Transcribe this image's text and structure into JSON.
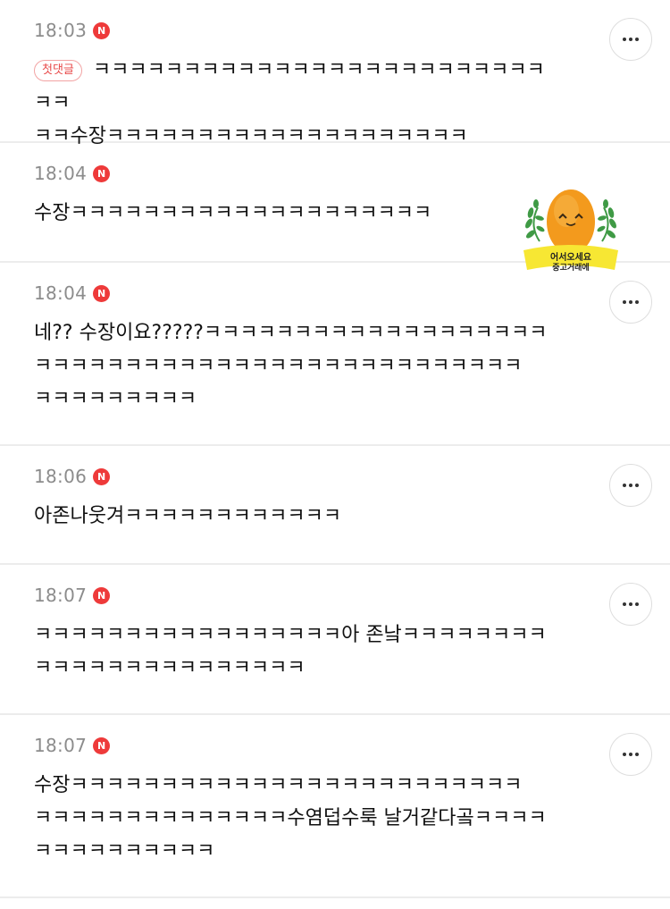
{
  "comments": [
    {
      "time": "18:03",
      "new_badge": "N",
      "first_badge": "첫댓글",
      "text": "ㅋㅋㅋㅋㅋㅋㅋㅋㅋㅋㅋㅋㅋㅋㅋㅋㅋㅋㅋㅋㅋㅋㅋㅋㅋㅋㅋ\nㅋㅋ수장ㅋㅋㅋㅋㅋㅋㅋㅋㅋㅋㅋㅋㅋㅋㅋㅋㅋㅋㅋㅋ"
    },
    {
      "time": "18:04",
      "new_badge": "N",
      "text": "수장ㅋㅋㅋㅋㅋㅋㅋㅋㅋㅋㅋㅋㅋㅋㅋㅋㅋㅋㅋㅋ",
      "sticker": {
        "line1": "어서오세요",
        "line2": "중고거래에"
      }
    },
    {
      "time": "18:04",
      "new_badge": "N",
      "text": "네?? 수장이요?????ㅋㅋㅋㅋㅋㅋㅋㅋㅋㅋㅋㅋㅋㅋㅋㅋㅋㅋㅋ\nㅋㅋㅋㅋㅋㅋㅋㅋㅋㅋㅋㅋㅋㅋㅋㅋㅋㅋㅋㅋㅋㅋㅋㅋㅋㅋㅋ\nㅋㅋㅋㅋㅋㅋㅋㅋㅋ"
    },
    {
      "time": "18:06",
      "new_badge": "N",
      "text": "아존나웃겨ㅋㅋㅋㅋㅋㅋㅋㅋㅋㅋㅋㅋ"
    },
    {
      "time": "18:07",
      "new_badge": "N",
      "text": "ㅋㅋㅋㅋㅋㅋㅋㅋㅋㅋㅋㅋㅋㅋㅋㅋㅋ아 존낰ㅋㅋㅋㅋㅋㅋㅋㅋ\nㅋㅋㅋㅋㅋㅋㅋㅋㅋㅋㅋㅋㅋㅋㅋ"
    },
    {
      "time": "18:07",
      "new_badge": "N",
      "text": "수장ㅋㅋㅋㅋㅋㅋㅋㅋㅋㅋㅋㅋㅋㅋㅋㅋㅋㅋㅋㅋㅋㅋㅋㅋㅋ\nㅋㅋㅋㅋㅋㅋㅋㅋㅋㅋㅋㅋㅋㅋ수염덥수룩 날거같다곸ㅋㅋㅋㅋ\nㅋㅋㅋㅋㅋㅋㅋㅋㅋㅋ"
    }
  ],
  "colors": {
    "badge_red": "#ee3a3a",
    "time_gray": "#8c8c8c",
    "divider": "#ececec"
  },
  "icons": {
    "more": "more-dots-icon"
  }
}
